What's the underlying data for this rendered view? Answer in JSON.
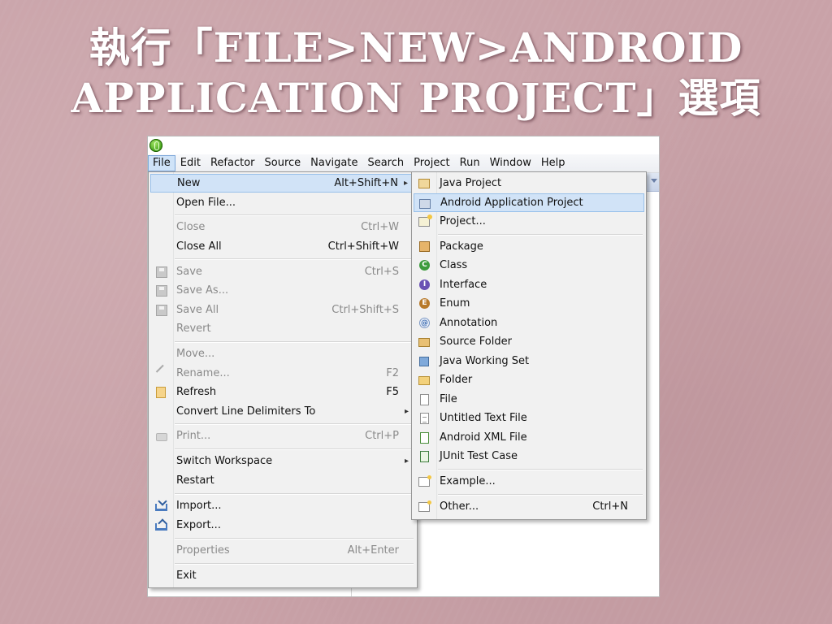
{
  "slide": {
    "title_line1": "執行「FILE>NEW>ANDROID",
    "title_line2": "APPLICATION PROJECT」選項"
  },
  "menubar": [
    "File",
    "Edit",
    "Refactor",
    "Source",
    "Navigate",
    "Search",
    "Project",
    "Run",
    "Window",
    "Help"
  ],
  "file_menu": {
    "new": {
      "label": "New",
      "accel": "Alt+Shift+N"
    },
    "open_file": {
      "label": "Open File..."
    },
    "close": {
      "label": "Close",
      "accel": "Ctrl+W"
    },
    "close_all": {
      "label": "Close All",
      "accel": "Ctrl+Shift+W"
    },
    "save": {
      "label": "Save",
      "accel": "Ctrl+S"
    },
    "save_as": {
      "label": "Save As..."
    },
    "save_all": {
      "label": "Save All",
      "accel": "Ctrl+Shift+S"
    },
    "revert": {
      "label": "Revert"
    },
    "move": {
      "label": "Move..."
    },
    "rename": {
      "label": "Rename...",
      "accel": "F2"
    },
    "refresh": {
      "label": "Refresh",
      "accel": "F5"
    },
    "convert": {
      "label": "Convert Line Delimiters To"
    },
    "print": {
      "label": "Print...",
      "accel": "Ctrl+P"
    },
    "switch_ws": {
      "label": "Switch Workspace"
    },
    "restart": {
      "label": "Restart"
    },
    "import": {
      "label": "Import..."
    },
    "export": {
      "label": "Export..."
    },
    "properties": {
      "label": "Properties",
      "accel": "Alt+Enter"
    },
    "exit": {
      "label": "Exit"
    }
  },
  "new_menu": {
    "java_project": "Java Project",
    "android_app_project": "Android Application Project",
    "project": "Project...",
    "package": "Package",
    "class": "Class",
    "interface": "Interface",
    "enum": "Enum",
    "annotation": "Annotation",
    "source_folder": "Source Folder",
    "java_working_set": "Java Working Set",
    "folder": "Folder",
    "file": "File",
    "untitled_text": "Untitled Text File",
    "android_xml": "Android XML File",
    "junit": "JUnit Test Case",
    "example": "Example...",
    "other": {
      "label": "Other...",
      "accel": "Ctrl+N"
    }
  },
  "submenu_arrow": "▸",
  "colors": {
    "highlight": "#d1e3f7",
    "highlight_border": "#98c0ea",
    "slide_bg": "#c9a2a8"
  }
}
